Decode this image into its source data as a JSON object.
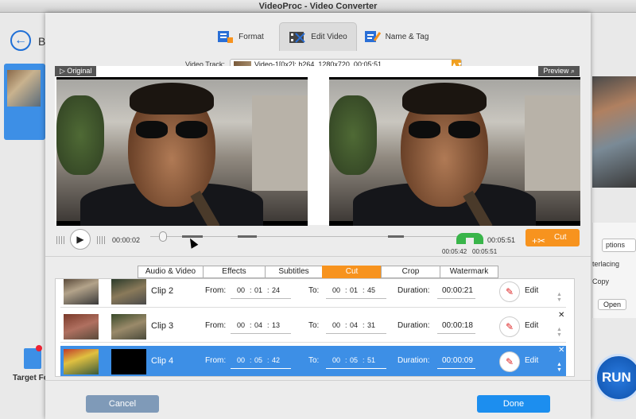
{
  "window": {
    "title": "VideoProc - Video Converter"
  },
  "background": {
    "back_letter": "B",
    "target_format_label": "Target Fo",
    "options_label": "ptions",
    "interlacing_label": "terlacing",
    "copy_label": "Copy",
    "open_label": "Open",
    "run_label": "RUN"
  },
  "tabs": [
    {
      "label": "Format",
      "icon": "format-icon"
    },
    {
      "label": "Edit Video",
      "icon": "edit-video-icon",
      "active": true
    },
    {
      "label": "Name & Tag",
      "icon": "name-tag-icon"
    }
  ],
  "video_track": {
    "label": "Video Track:",
    "value": "Video-1[0x2]: h264, 1280x720, 00:05:51"
  },
  "preview": {
    "original_label": "Original",
    "preview_label": "Preview"
  },
  "player": {
    "current_time": "00:00:02",
    "end_time": "00:05:51",
    "marker_start": "00:05:42",
    "marker_end": "00:05:51",
    "cut_label": "Cut"
  },
  "subtabs": [
    {
      "label": "Audio & Video"
    },
    {
      "label": "Effects"
    },
    {
      "label": "Subtitles"
    },
    {
      "label": "Cut",
      "active": true
    },
    {
      "label": "Crop"
    },
    {
      "label": "Watermark"
    }
  ],
  "clips": [
    {
      "name": "Clip 2",
      "from_label": "From:",
      "from": [
        "00",
        "01",
        "24"
      ],
      "to_label": "To:",
      "to": [
        "00",
        "01",
        "45"
      ],
      "duration_label": "Duration:",
      "duration": "00:00:21",
      "edit_label": "Edit"
    },
    {
      "name": "Clip 3",
      "from_label": "From:",
      "from": [
        "00",
        "04",
        "13"
      ],
      "to_label": "To:",
      "to": [
        "00",
        "04",
        "31"
      ],
      "duration_label": "Duration:",
      "duration": "00:00:18",
      "edit_label": "Edit"
    },
    {
      "name": "Clip 4",
      "from_label": "From:",
      "from": [
        "00",
        "05",
        "42"
      ],
      "to_label": "To:",
      "to": [
        "00",
        "05",
        "51"
      ],
      "duration_label": "Duration:",
      "duration": "00:00:09",
      "edit_label": "Edit",
      "selected": true
    }
  ],
  "footer": {
    "cancel_label": "Cancel",
    "done_label": "Done"
  },
  "colors": {
    "accent": "#f7931e",
    "selection": "#3d8fe6",
    "done": "#1c8eef",
    "cancel": "#7f9ab8"
  }
}
